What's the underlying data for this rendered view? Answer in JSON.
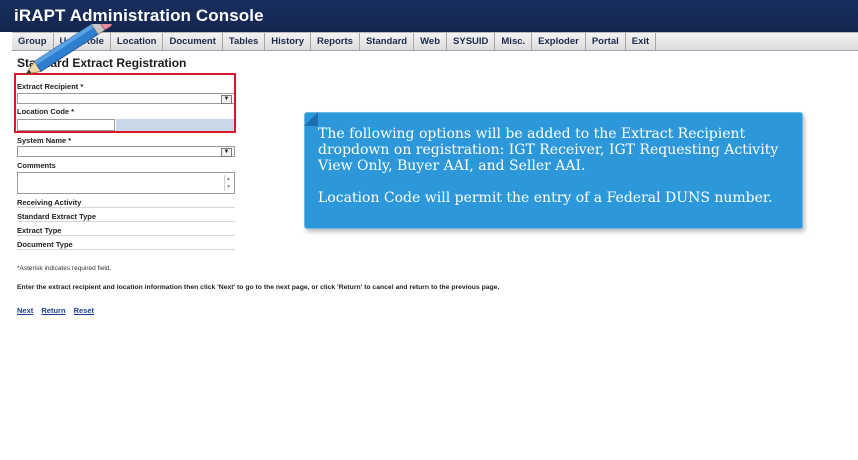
{
  "app": {
    "title": "iRAPT Administration Console"
  },
  "menu": [
    "Group",
    "User Role",
    "Location",
    "Document",
    "Tables",
    "History",
    "Reports",
    "Standard",
    "Web",
    "SYSUID",
    "Misc.",
    "Exploder",
    "Portal",
    "Exit"
  ],
  "page": {
    "heading": "Standard Extract Registration"
  },
  "form": {
    "extract_recipient_label": "Extract Recipient *",
    "location_code_label": "Location Code *",
    "system_name_label": "System Name *",
    "comments_label": "Comments",
    "receiving_activity_label": "Receiving Activity",
    "standard_extract_type_label": "Standard Extract Type",
    "extract_type_label": "Extract Type",
    "document_type_label": "Document Type"
  },
  "notes": {
    "asterisk": "*Asterisk indicates required field.",
    "instruction": "Enter the extract recipient and location information then click 'Next' to go to the next page, or click 'Return' to cancel and return to the previous page."
  },
  "links": {
    "next": "Next",
    "return": "Return",
    "reset": "Reset"
  },
  "callout": {
    "p1": "The following options will be added to the Extract Recipient dropdown on registration: IGT Receiver, IGT Requesting Activity View Only, Buyer AAI, and Seller AAI.",
    "p2": "Location Code will permit the entry of a Federal DUNS number."
  },
  "colors": {
    "title_bar": "#13264f",
    "callout": "#2d98d9",
    "highlight_box": "#d8152a"
  },
  "icons": [
    "pencil-icon",
    "dropdown-arrow-icon"
  ]
}
